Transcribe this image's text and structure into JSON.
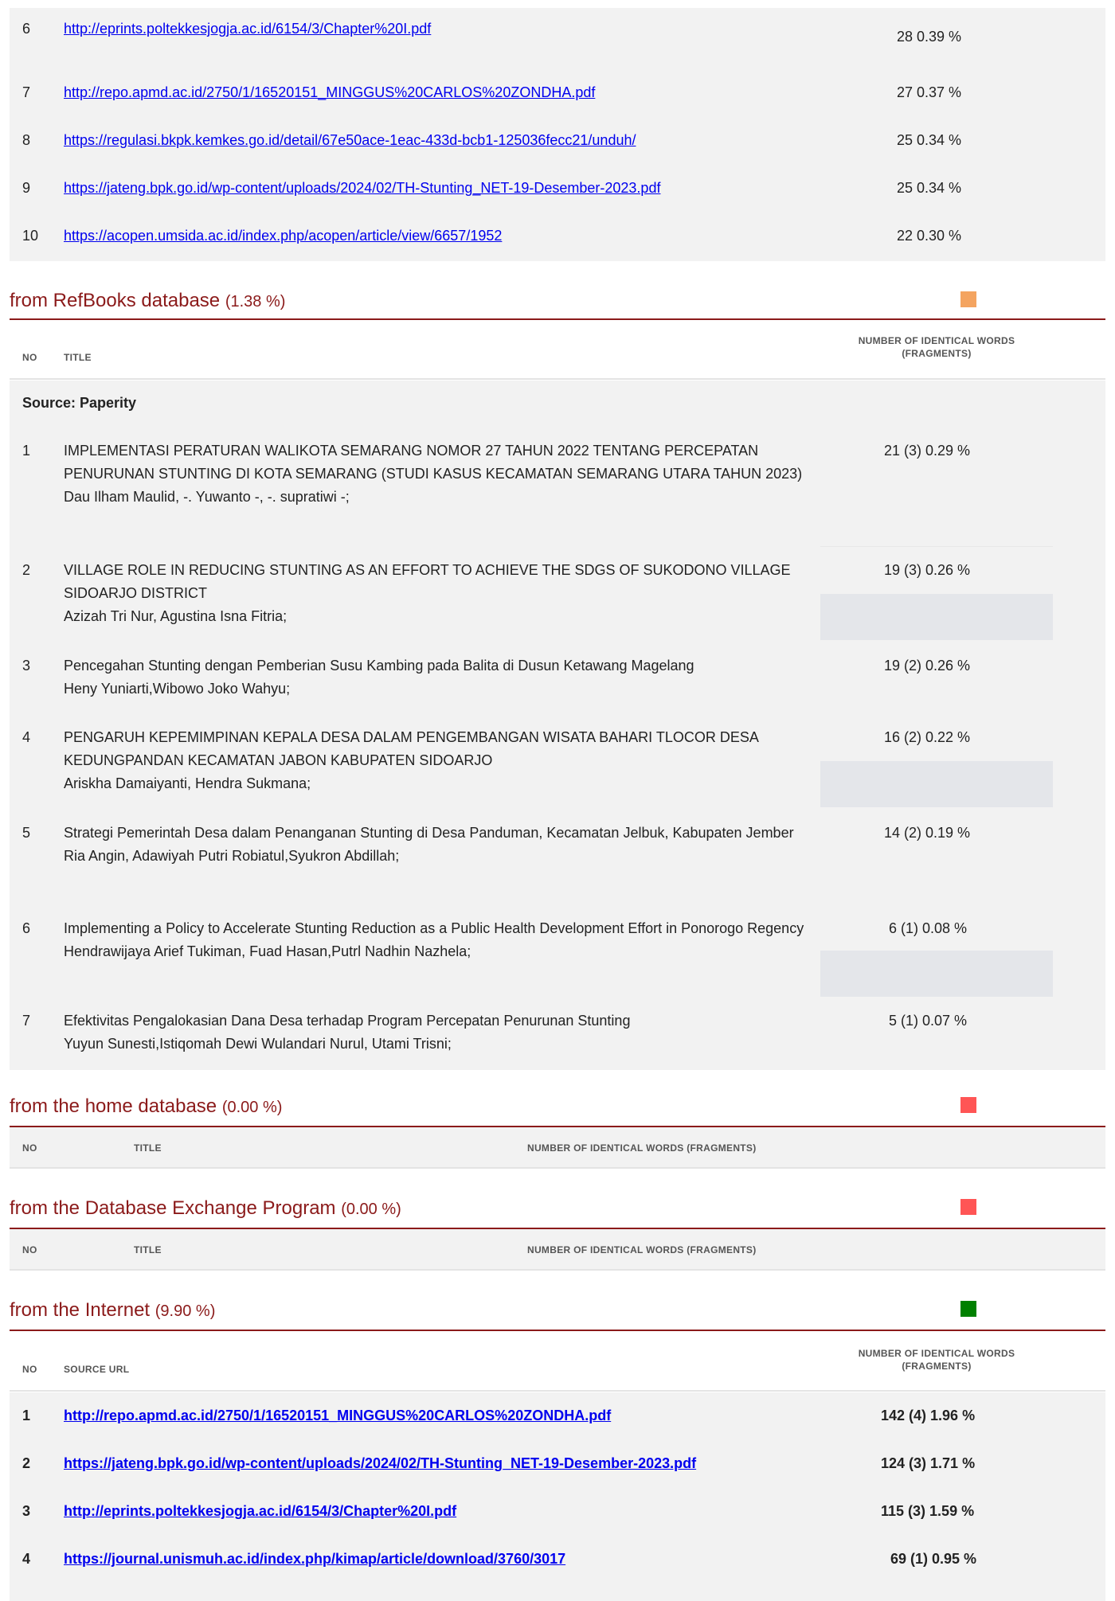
{
  "top_urls": [
    {
      "no": "6",
      "url": "http://eprints.poltekkesjogja.ac.id/6154/3/Chapter%20I.pdf",
      "value": "28  0.39 %"
    },
    {
      "no": "7",
      "url": "http://repo.apmd.ac.id/2750/1/16520151_MINGGUS%20CARLOS%20ZONDHA.pdf",
      "value": "27  0.37 %"
    },
    {
      "no": "8",
      "url": "https://regulasi.bkpk.kemkes.go.id/detail/67e50ace-1eac-433d-bcb1-125036fecc21/unduh/",
      "value": "25  0.34 %"
    },
    {
      "no": "9",
      "url": "https://jateng.bpk.go.id/wp-content/uploads/2024/02/TH-Stunting_NET-19-Desember-2023.pdf",
      "value": "25  0.34 %"
    },
    {
      "no": "10",
      "url": "https://acopen.umsida.ac.id/index.php/acopen/article/view/6657/1952",
      "value": "22  0.30 %"
    }
  ],
  "refbooks": {
    "title": "from RefBooks database",
    "pct": "(1.38 %)",
    "swatch_color": "#f4a460",
    "col_no": "NO",
    "col_title": "TITLE",
    "col_count_line1": "NUMBER OF IDENTICAL WORDS",
    "col_count_line2": "(FRAGMENTS)",
    "source_label": "Source: Paperity",
    "items": [
      {
        "no": "1",
        "title": "IMPLEMENTASI PERATURAN WALIKOTA SEMARANG NOMOR 27 TAHUN 2022 TENTANG PERCEPATAN PENURUNAN STUNTING DI KOTA SEMARANG (STUDI KASUS KECAMATAN SEMARANG UTARA TAHUN 2023)",
        "authors": "Dau Ilham Maulid, -. Yuwanto -, -. supratiwi -;",
        "value": "21 (3)  0.29 %"
      },
      {
        "no": "2",
        "title": "VILLAGE ROLE IN REDUCING STUNTING AS AN EFFORT TO ACHIEVE THE SDGS OF SUKODONO VILLAGE SIDOARJO DISTRICT",
        "authors": "Azizah Tri Nur, Agustina Isna Fitria;",
        "value": "19 (3)  0.26 %"
      },
      {
        "no": "3",
        "title": "Pencegahan Stunting dengan Pemberian Susu Kambing pada Balita di Dusun Ketawang Magelang",
        "authors": "Heny Yuniarti,Wibowo Joko Wahyu;",
        "value": "19 (2)  0.26 %"
      },
      {
        "no": "4",
        "title": "PENGARUH KEPEMIMPINAN KEPALA DESA DALAM PENGEMBANGAN WISATA BAHARI TLOCOR DESA KEDUNGPANDAN KECAMATAN JABON KABUPATEN SIDOARJO",
        "authors": "Ariskha Damaiyanti, Hendra Sukmana;",
        "value": "16 (2)  0.22 %"
      },
      {
        "no": "5",
        "title": "Strategi Pemerintah Desa dalam Penanganan Stunting di Desa Panduman, Kecamatan Jelbuk, Kabupaten Jember",
        "authors": "Ria Angin, Adawiyah Putri Robiatul,Syukron Abdillah;",
        "value": "14 (2)  0.19 %"
      },
      {
        "no": "6",
        "title": "Implementing a Policy to Accelerate Stunting Reduction as a Public Health Development Effort in Ponorogo Regency",
        "authors": "Hendrawijaya Arief Tukiman, Fuad Hasan,Putrl Nadhin Nazhela;",
        "value": "6 (1)  0.08 %"
      },
      {
        "no": "7",
        "title": "Efektivitas Pengalokasian Dana Desa terhadap Program Percepatan Penurunan Stunting",
        "authors": "Yuyun Sunesti,Istiqomah Dewi Wulandari Nurul, Utami Trisni;",
        "value": "5 (1)  0.07 %"
      }
    ]
  },
  "home": {
    "title": "from the home database",
    "pct": "(0.00 %)",
    "swatch_color": "#ff5555",
    "col_no": "NO",
    "col_title": "TITLE",
    "col_count": "NUMBER OF IDENTICAL WORDS (FRAGMENTS)"
  },
  "exchange": {
    "title": "from the Database Exchange Program",
    "pct": "(0.00 %)",
    "swatch_color": "#ff5555",
    "col_no": "NO",
    "col_title": "TITLE",
    "col_count": "NUMBER OF IDENTICAL WORDS (FRAGMENTS)"
  },
  "internet": {
    "title": "from the Internet",
    "pct": "(9.90 %)",
    "swatch_color": "#008000",
    "col_no": "NO",
    "col_url": "SOURCE URL",
    "col_count_line1": "NUMBER OF IDENTICAL WORDS",
    "col_count_line2": "(FRAGMENTS)",
    "items": [
      {
        "no": "1",
        "url": "http://repo.apmd.ac.id/2750/1/16520151_MINGGUS%20CARLOS%20ZONDHA.pdf",
        "value": "142 (4)  1.96 %"
      },
      {
        "no": "2",
        "url": "https://jateng.bpk.go.id/wp-content/uploads/2024/02/TH-Stunting_NET-19-Desember-2023.pdf",
        "value": "124 (3)  1.71 %"
      },
      {
        "no": "3",
        "url": "http://eprints.poltekkesjogja.ac.id/6154/3/Chapter%20I.pdf",
        "value": "115 (3)  1.59 %"
      },
      {
        "no": "4",
        "url": "https://journal.unismuh.ac.id/index.php/kimap/article/download/3760/3017",
        "value": "69 (1)  0.95 %"
      }
    ]
  }
}
